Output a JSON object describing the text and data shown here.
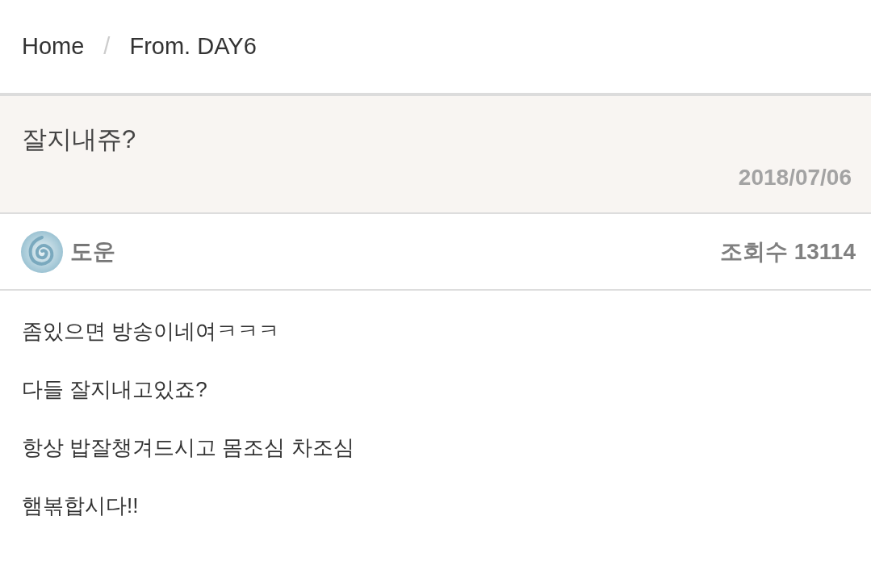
{
  "breadcrumb": {
    "items": [
      "Home",
      "From. DAY6"
    ],
    "separator": "/"
  },
  "post": {
    "title": "잘지내쥬?",
    "date": "2018/07/06",
    "author": "도운",
    "views": "조회수 13114",
    "body": [
      "좀있으면 방송이네여ㅋㅋㅋ",
      "다들 잘지내고있죠?",
      "항상 밥잘챙겨드시고 몸조심 차조심",
      "햄볶합시다!!"
    ]
  }
}
